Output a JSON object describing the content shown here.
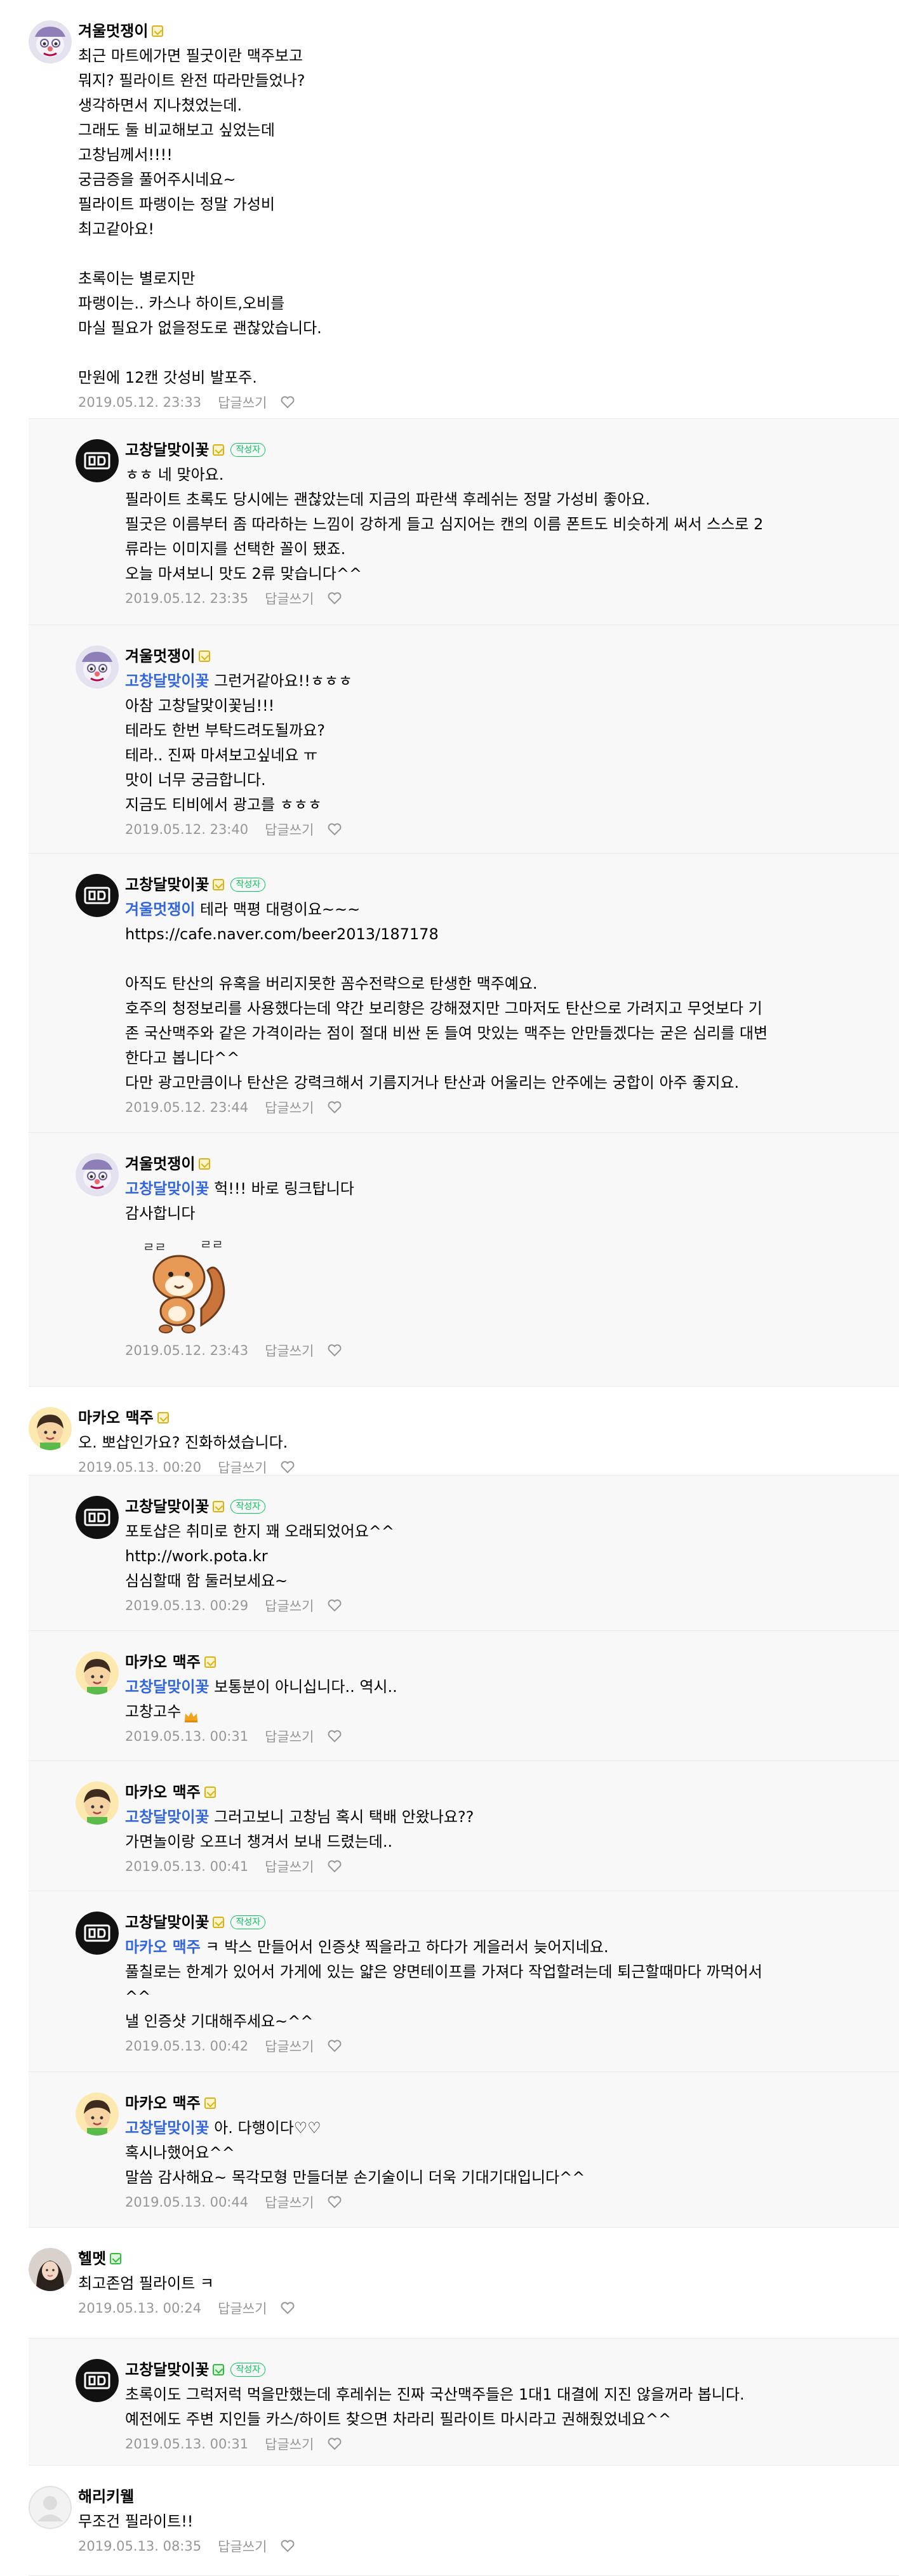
{
  "comments": [
    {
      "nick": "겨울멋쟁이",
      "level": "gold",
      "avatar": "clown-avatar-icon",
      "lines": [
        "최근 마트에가면 필굿이란 맥주보고",
        "뭐지? 필라이트 완전 따라만들었나?",
        "생각하면서 지나쳤었는데.",
        "그래도 둘 비교해보고 싶었는데",
        "고창님께서!!!!",
        "궁금증을 풀어주시네요~",
        "필라이트 파랭이는 정말 가성비",
        "최고같아요!",
        "",
        "초록이는 별로지만",
        "파랭이는.. 카스나 하이트,오비를",
        "마실 필요가 없을정도로 괜찮았습니다.",
        "",
        "만원에 12캔 갓성비 발포주."
      ],
      "date": "2019.05.12. 23:33",
      "reply_label": "답글쓰기"
    },
    {
      "nick": "고창달맞이꽃",
      "level": "gold",
      "author_tag": "작성자",
      "avatar": "gd-logo-avatar-icon",
      "lines": [
        "ㅎㅎ 네 맞아요.",
        "필라이트 초록도 당시에는 괜찮았는데 지금의 파란색 후레쉬는 정말 가성비 좋아요.",
        "필굿은 이름부터 좀 따라하는 느낌이 강하게 들고 심지어는 캔의 이름 폰트도 비슷하게 써서 스스로 2",
        "류라는 이미지를 선택한 꼴이 됐죠.",
        "오늘 마셔보니 맛도 2류 맞습니다^^"
      ],
      "date": "2019.05.12. 23:35",
      "reply_label": "답글쓰기"
    },
    {
      "nick": "겨울멋쟁이",
      "level": "gold",
      "avatar": "clown-avatar-icon",
      "mention": "고창달맞이꽃",
      "first_rest": " 그런거같아요!!ㅎㅎㅎ",
      "lines": [
        "아참 고창달맞이꽃님!!!",
        "테라도 한번 부탁드려도될까요?",
        "테라.. 진짜 마셔보고싶네요 ㅠ",
        "맛이 너무 궁금합니다.",
        "지금도 티비에서 광고를 ㅎㅎㅎ"
      ],
      "date": "2019.05.12. 23:40",
      "reply_label": "답글쓰기"
    },
    {
      "nick": "고창달맞이꽃",
      "level": "gold",
      "author_tag": "작성자",
      "avatar": "gd-logo-avatar-icon",
      "mention": "겨울멋쟁이",
      "first_rest": " 테라 맥평 대령이요~~~",
      "lines": [
        "https://cafe.naver.com/beer2013/187178",
        "",
        "아직도 탄산의 유혹을 버리지못한 꼼수전략으로 탄생한 맥주예요.",
        "호주의 청정보리를 사용했다는데 약간 보리향은 강해졌지만 그마저도 탄산으로 가려지고 무엇보다 기",
        "존 국산맥주와 같은 가격이라는 점이 절대 비싼 돈 들여 맛있는 맥주는 안만들겠다는 굳은 심리를 대변",
        "한다고 봅니다^^",
        "다만 광고만큼이나 탄산은 강력크해서 기름지거나 탄산과 어울리는 안주에는 궁합이 아주 좋지요."
      ],
      "date": "2019.05.12. 23:44",
      "reply_label": "답글쓰기"
    },
    {
      "nick": "겨울멋쟁이",
      "level": "gold",
      "avatar": "clown-avatar-icon",
      "mention": "고창달맞이꽃",
      "first_rest": " 헉!!! 바로 링크탑니다",
      "lines": [
        "감사합니다"
      ],
      "sticker": "squirrel-sticker-icon",
      "date": "2019.05.12. 23:43",
      "reply_label": "답글쓰기"
    },
    {
      "nick": "마카오 맥주",
      "level": "gold",
      "avatar": "boy-avatar-icon",
      "lines": [
        "오. 뽀샵인가요? 진화하셨습니다."
      ],
      "date": "2019.05.13. 00:20",
      "reply_label": "답글쓰기"
    },
    {
      "nick": "고창달맞이꽃",
      "level": "gold",
      "author_tag": "작성자",
      "avatar": "gd-logo-avatar-icon",
      "lines": [
        "포토샵은 취미로 한지 꽤 오래되었어요^^",
        "http://work.pota.kr",
        "심심할때 함 둘러보세요~"
      ],
      "date": "2019.05.13. 00:29",
      "reply_label": "답글쓰기"
    },
    {
      "nick": "마카오 맥주",
      "level": "gold",
      "avatar": "boy-avatar-icon",
      "mention": "고창달맞이꽃",
      "first_rest": " 보통분이 아니십니다.. 역시..",
      "lines": [
        "고창고수"
      ],
      "crown": "crown-icon",
      "date": "2019.05.13. 00:31",
      "reply_label": "답글쓰기"
    },
    {
      "nick": "마카오 맥주",
      "level": "gold",
      "avatar": "boy-avatar-icon",
      "mention": "고창달맞이꽃",
      "first_rest": " 그러고보니 고창님 혹시 택배 안왔나요??",
      "lines": [
        "가면놀이랑 오프너 챙겨서 보내 드렸는데.."
      ],
      "date": "2019.05.13. 00:41",
      "reply_label": "답글쓰기"
    },
    {
      "nick": "고창달맞이꽃",
      "level": "gold",
      "author_tag": "작성자",
      "avatar": "gd-logo-avatar-icon",
      "mention": "마카오 맥주",
      "first_rest": " ㅋ 박스 만들어서 인증샷 찍을라고 하다가 게을러서 늦어지네요.",
      "lines": [
        "풀칠로는 한계가 있어서 가게에 있는 얇은 양면테이프를 가져다 작업할려는데 퇴근할때마다 까먹어서",
        "^^",
        "낼 인증샷 기대해주세요~^^"
      ],
      "date": "2019.05.13. 00:42",
      "reply_label": "답글쓰기"
    },
    {
      "nick": "마카오 맥주",
      "level": "gold",
      "avatar": "boy-avatar-icon",
      "mention": "고창달맞이꽃",
      "first_rest": " 아. 다행이다♡♡",
      "lines": [
        "혹시나했어요^^",
        "말씀 감사해요~ 목각모형 만들더분 손기술이니 더욱 기대기대입니다^^"
      ],
      "date": "2019.05.13. 00:44",
      "reply_label": "답글쓰기"
    },
    {
      "nick": "헬멧",
      "level": "green",
      "avatar": "woman-avatar-icon",
      "lines": [
        "최고존엄 필라이트 ㅋ"
      ],
      "date": "2019.05.13. 00:24",
      "reply_label": "답글쓰기"
    },
    {
      "nick": "고창달맞이꽃",
      "level": "green",
      "author_tag": "작성자",
      "avatar": "gd-logo-avatar-icon",
      "lines": [
        "초록이도 그럭저럭 먹을만했는데 후레쉬는 진짜 국산맥주들은 1대1 대결에 지진 않을꺼라 봅니다.",
        "예전에도 주변 지인들 카스/하이트 찾으면 차라리 필라이트 마시라고 권해줬었네요^^"
      ],
      "date": "2019.05.13. 00:31",
      "reply_label": "답글쓰기"
    },
    {
      "nick": "해리키웰",
      "level": "none",
      "avatar": "default-avatar-icon",
      "lines": [
        "무조건 필라이트!!"
      ],
      "date": "2019.05.13. 08:35",
      "reply_label": "답글쓰기"
    }
  ]
}
